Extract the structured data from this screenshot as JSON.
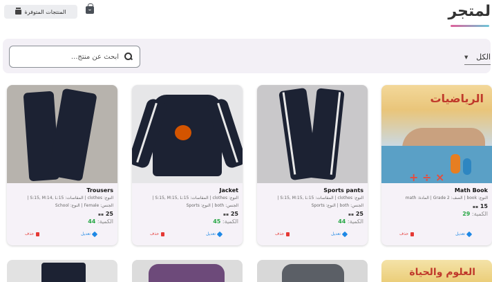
{
  "header": {
    "title": "لمتجر",
    "available_button": "المنتجات المتوفرة"
  },
  "filter": {
    "search_placeholder": "ابحث عن منتج...",
    "category_value": "الكل"
  },
  "products": [
    {
      "name": "Math Book",
      "meta_line1": "النوع: book | الصف: Grade 2 | المادة: math",
      "meta_line2": "",
      "price": "15",
      "qty_label": "الكمية:",
      "qty": "29",
      "image_title": "الرياضيات"
    },
    {
      "name": "Sports pants",
      "meta_line1": "النوع: clothes | المقاسات: S:15, M:15, L:15 |",
      "meta_line2": "الجنس: both | النوع: Sports",
      "price": "25",
      "qty_label": "الكمية:",
      "qty": "44"
    },
    {
      "name": "Jacket",
      "meta_line1": "النوع: clothes | المقاسات: S:15, M:15, L:15 |",
      "meta_line2": "الجنس: both | النوع: Sports",
      "price": "25",
      "qty_label": "الكمية:",
      "qty": "45"
    },
    {
      "name": "Trousers",
      "meta_line1": "النوع: clothes | المقاسات: S:15, M:14, L:15 |",
      "meta_line2": "الجنس: Female | النوع: School",
      "price": "25",
      "qty_label": "الكمية:",
      "qty": "44"
    }
  ],
  "actions": {
    "edit": "تعديل",
    "delete": "حذف"
  },
  "row2": {
    "science_title": "العلوم والحياة"
  },
  "colors": {
    "accent_green": "#28a745",
    "edit_blue": "#1e88e5",
    "delete_red": "#e53935"
  }
}
